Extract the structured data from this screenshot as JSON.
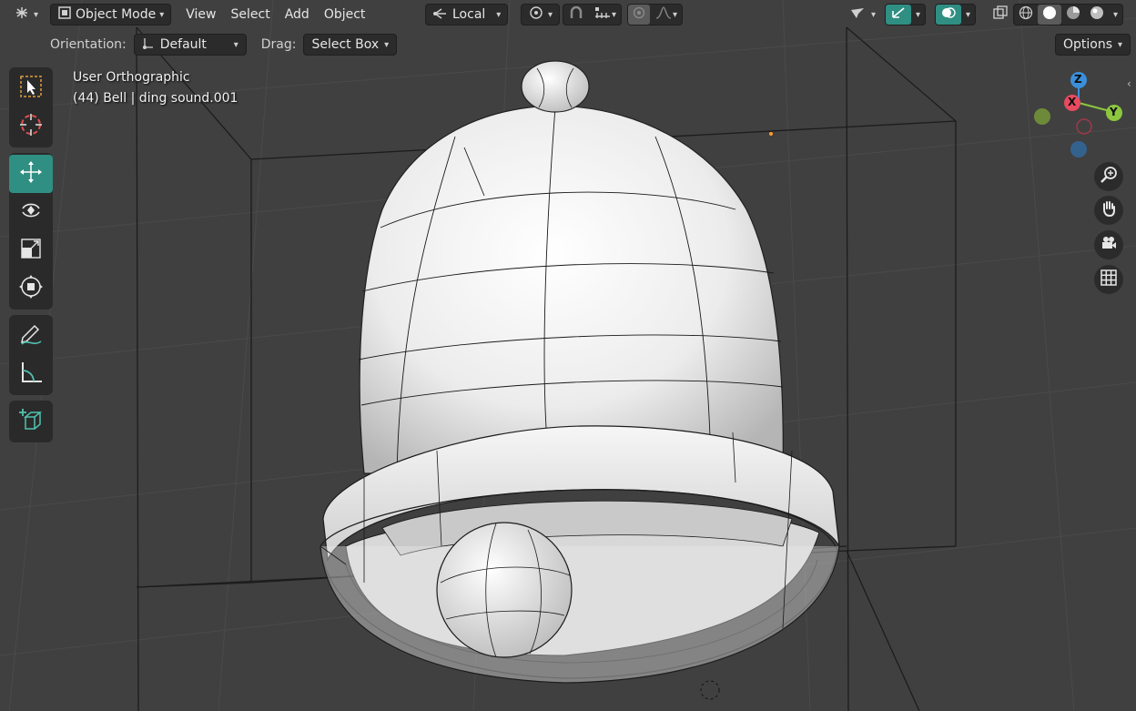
{
  "header": {
    "mode_label": "Object Mode",
    "menus": [
      "View",
      "Select",
      "Add",
      "Object"
    ],
    "transform_orientation": "Local"
  },
  "tool_settings": {
    "orientation_label": "Orientation:",
    "orientation_value": "Default",
    "drag_label": "Drag:",
    "drag_value": "Select Box",
    "options_label": "Options"
  },
  "viewport": {
    "view_name": "User Orthographic",
    "object_info": "(44) Bell | ding sound.001"
  },
  "gizmo": {
    "z_label": "Z",
    "x_label": "X",
    "y_label": "Y",
    "colors": {
      "x": "#e84a5f",
      "y": "#8cc63f",
      "z": "#3b8fd9"
    }
  },
  "icons": {
    "tools": [
      "select-box-icon",
      "cursor-icon",
      "move-icon",
      "rotate-icon",
      "scale-icon",
      "transform-icon",
      "annotate-icon",
      "measure-icon",
      "add-cube-icon"
    ],
    "nav": [
      "zoom-icon",
      "pan-hand-icon",
      "camera-icon",
      "grid-icon"
    ]
  },
  "colors": {
    "accent": "#2f8f83",
    "background": "#404040"
  }
}
